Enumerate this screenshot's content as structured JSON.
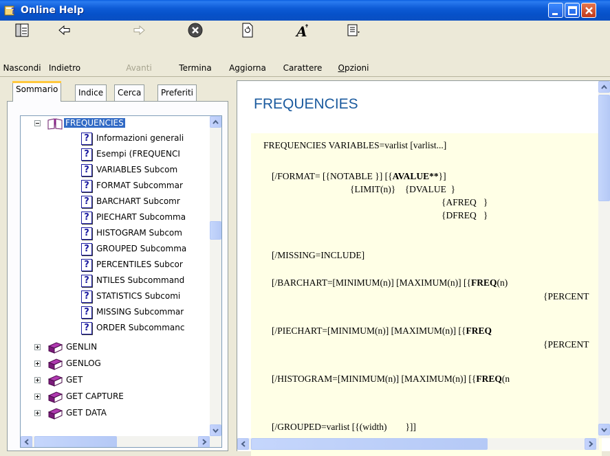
{
  "window": {
    "title": "Online Help"
  },
  "toolbar": {
    "buttons": [
      {
        "id": "hide",
        "label": "Nascondi",
        "icon": "hide-pane-icon",
        "enabled": true
      },
      {
        "id": "back",
        "label": "Indietro",
        "icon": "back-arrow-icon",
        "enabled": true
      },
      {
        "id": "forward",
        "label": "Avanti",
        "icon": "forward-arrow-icon",
        "enabled": false
      },
      {
        "id": "stop",
        "label": "Termina",
        "icon": "stop-icon",
        "enabled": true
      },
      {
        "id": "refresh",
        "label": "Aggiorna",
        "icon": "refresh-icon",
        "enabled": true
      },
      {
        "id": "font",
        "label": "Carattere",
        "icon": "font-icon",
        "enabled": true
      },
      {
        "id": "options",
        "label": "Opzioni",
        "icon": "options-icon",
        "enabled": true
      }
    ]
  },
  "tabs": [
    {
      "label": "Sommario",
      "active": true
    },
    {
      "label": "Indice",
      "active": false
    },
    {
      "label": "Cerca",
      "active": false
    },
    {
      "label": "Preferiti",
      "active": false
    }
  ],
  "tree": {
    "open_book": {
      "label": "FREQUENCIES",
      "selected": true
    },
    "topics": [
      "Informazioni generali",
      "Esempi (FREQUENCI",
      "VARIABLES Subcom",
      "FORMAT Subcommar",
      "BARCHART Subcomr",
      "PIECHART Subcomma",
      "HISTOGRAM Subcom",
      "GROUPED Subcomma",
      "PERCENTILES Subcor",
      "NTILES Subcommand",
      "STATISTICS Subcomi",
      "MISSING Subcommar",
      "ORDER Subcommanc"
    ],
    "closed_books": [
      "GENLIN",
      "GENLOG",
      "GET",
      "GET CAPTURE",
      "GET DATA"
    ]
  },
  "content": {
    "heading": "FREQUENCIES",
    "syntax": {
      "line1": "FREQUENCIES VARIABLES=varlist [varlist...]",
      "format_a": "[/FORMAT= [{NOTABLE }] [{",
      "format_b": "AVALUE**",
      "format_c": "}]",
      "format_l2": "{LIMIT(n)}    {DVALUE  }",
      "format_l3": "{AFREQ   }",
      "format_l4": "{DFREQ   }",
      "missing": "[/MISSING=INCLUDE]",
      "barchart_a": "[/BARCHART=[MINIMUM(n)] [MAXIMUM(n)] [{",
      "barchart_b": "FREQ",
      "barchart_c": "(n)",
      "barchart_l2": "{PERCENT",
      "piechart_a": "[/PIECHART=[MINIMUM(n)] [MAXIMUM(n)] [{",
      "piechart_b": "FREQ",
      "piechart_l2": "{PERCENT",
      "histogram_a": "[/HISTOGRAM=[MINIMUM(n)] [MAXIMUM(n)] [{",
      "histogram_b": "FREQ",
      "histogram_c": "(n",
      "grouped": "[/GROUPED=varlist [{(width)        }]]"
    }
  },
  "colors": {
    "titlebar": "#0651c9",
    "heading": "#1a5a9e",
    "syntax_bg": "#ffffe6",
    "selection": "#316ac5"
  }
}
